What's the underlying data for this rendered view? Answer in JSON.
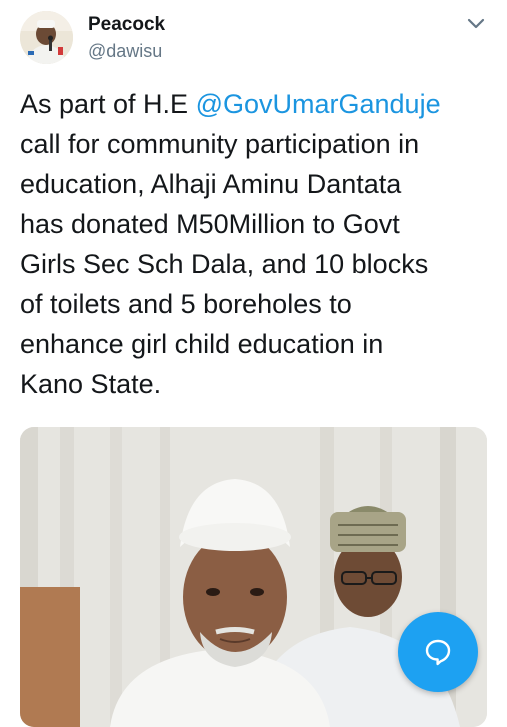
{
  "author": {
    "display_name": "Peacock",
    "handle": "@dawisu"
  },
  "tweet": {
    "lines": [
      {
        "before": "As part of H.E ",
        "mention": "@GovUmarGanduje",
        "after": ""
      },
      {
        "before": "call for community participation in",
        "mention": "",
        "after": ""
      },
      {
        "before": "education, Alhaji Aminu Dantata",
        "mention": "",
        "after": ""
      },
      {
        "before": "has donated M50Million to Govt",
        "mention": "",
        "after": ""
      },
      {
        "before": "Girls Sec Sch Dala, and 10 blocks",
        "mention": "",
        "after": ""
      },
      {
        "before": "of toilets and 5 boreholes to",
        "mention": "",
        "after": ""
      },
      {
        "before": "enhance girl child education in",
        "mention": "",
        "after": ""
      },
      {
        "before": "Kano State.",
        "mention": "",
        "after": ""
      }
    ]
  },
  "icons": {
    "caret": "chevron-down-icon",
    "compose": "reply-bubble-icon"
  },
  "colors": {
    "link": "#1b95e0",
    "fab": "#1da1f2",
    "secondary_text": "#657786",
    "primary_text": "#14171a"
  }
}
